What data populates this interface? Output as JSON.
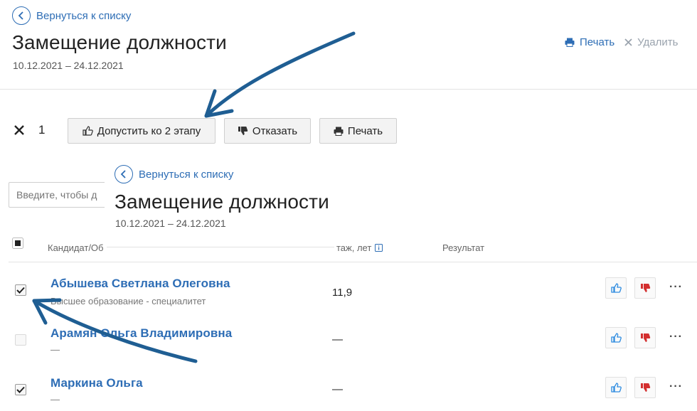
{
  "header": {
    "back_label": "Вернуться к списку",
    "title": "Замещение должности",
    "dates": "10.12.2021 – 24.12.2021",
    "print_label": "Печать",
    "delete_label": "Удалить"
  },
  "selection_bar": {
    "count": "1",
    "approve_label": "Допустить ко 2 этапу",
    "reject_label": "Отказать",
    "print_label": "Печать"
  },
  "search": {
    "placeholder": "Введите, чтобы д"
  },
  "overlay": {
    "back_label": "Вернуться к списку",
    "title": "Замещение должности",
    "dates": "10.12.2021 – 24.12.2021"
  },
  "table": {
    "columns": {
      "candidate": "Кандидат/Об",
      "experience": "таж, лет",
      "result": "Результат"
    },
    "rows": [
      {
        "name": "Абышева Светлана Олеговна",
        "education": "Высшее образование - специалитет",
        "experience": "11,9",
        "checked": true
      },
      {
        "name": "Арамян Ольга Владимировна",
        "education": "—",
        "experience": "—",
        "checked": false
      },
      {
        "name": "Маркина Ольга",
        "education": "—",
        "experience": "—",
        "checked": true
      }
    ]
  },
  "colors": {
    "link_blue": "#2d6db5",
    "arrow_blue": "#1f5e93",
    "thumb_up": "#2d8be0",
    "thumb_down": "#d32f2f"
  }
}
